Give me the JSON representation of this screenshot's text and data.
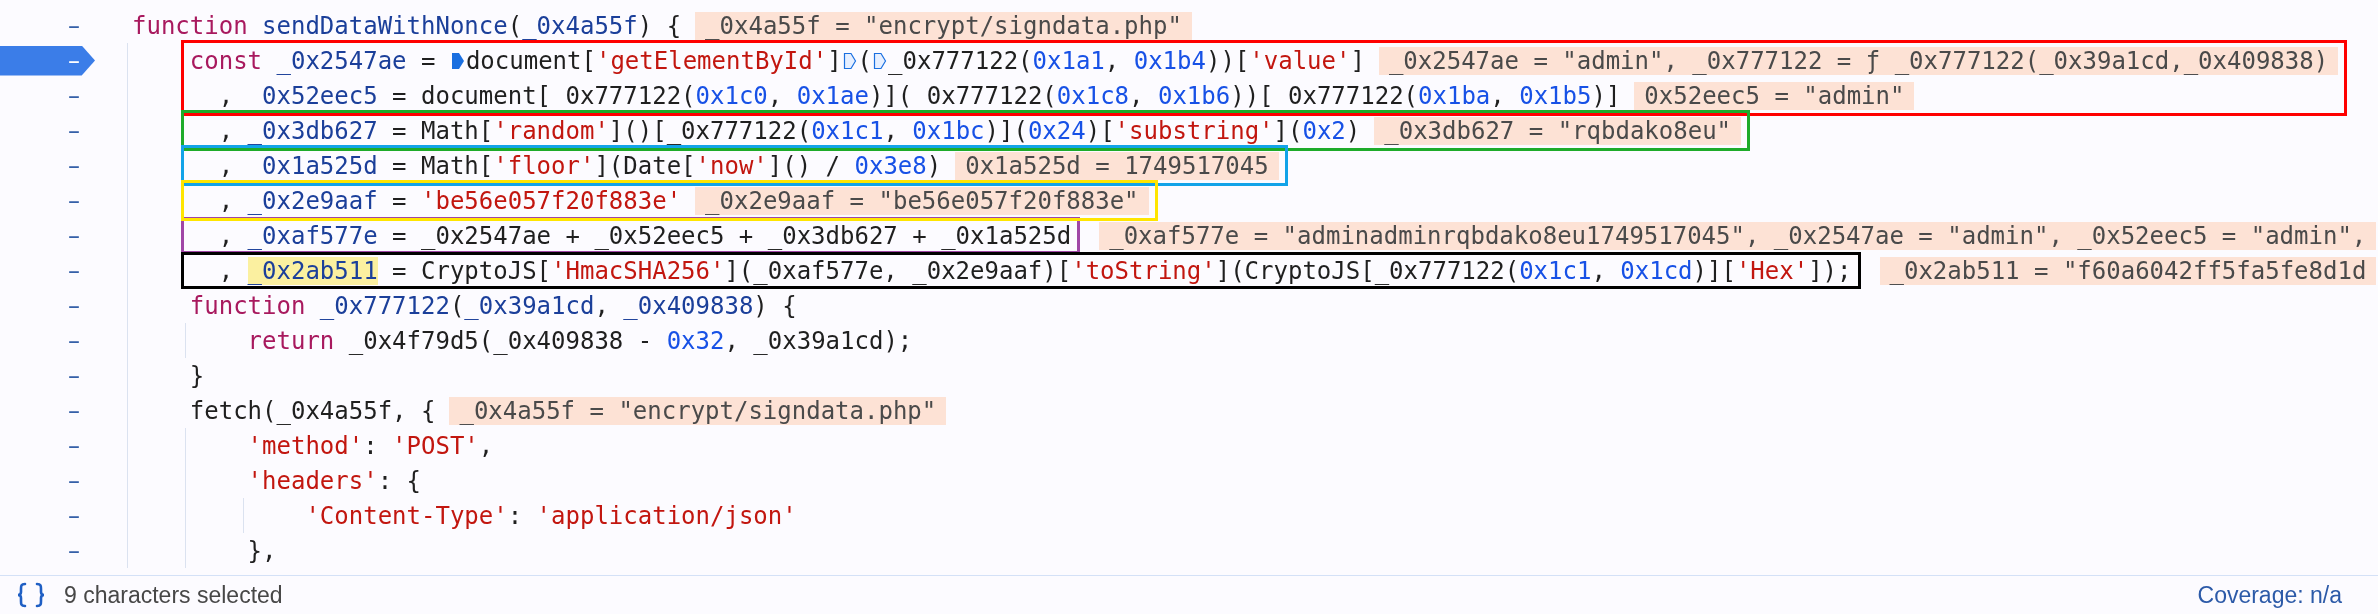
{
  "editor": {
    "lines": [
      {
        "gutter": "–",
        "breakpoint": false,
        "tokens": [
          {
            "text": "function",
            "kind": "keyword"
          },
          {
            "text": " sendDataWithNonce",
            "kind": "name"
          },
          {
            "text": "(",
            "kind": "plain"
          },
          {
            "text": "_0x4a55f",
            "kind": "name"
          },
          {
            "text": ") {",
            "kind": "plain"
          }
        ],
        "value": "_0x4a55f = \"encrypt/signdata.php\"",
        "children": [
          {
            "gutter": "–",
            "breakpoint": true,
            "color": "#ff0000",
            "value_in_frame": true,
            "tokens": [
              {
                "text": "const",
                "kind": "keyword"
              },
              {
                "text": " _0x2547ae",
                "kind": "name"
              },
              {
                "text": " = ",
                "kind": "plain"
              },
              {
                "kind": "marker-filled"
              },
              {
                "text": "document[",
                "kind": "plain"
              },
              {
                "text": "'getElementById'",
                "kind": "string"
              },
              {
                "text": "]",
                "kind": "plain"
              },
              {
                "kind": "marker-outline"
              },
              {
                "text": "(",
                "kind": "plain"
              },
              {
                "kind": "marker-outline"
              },
              {
                "text": "_0x777122(",
                "kind": "plain"
              },
              {
                "text": "0x1a1",
                "kind": "number"
              },
              {
                "text": ", ",
                "kind": "plain"
              },
              {
                "text": "0x1b4",
                "kind": "number"
              },
              {
                "text": "))[",
                "kind": "plain"
              },
              {
                "text": "'value'",
                "kind": "string"
              },
              {
                "text": "]",
                "kind": "plain"
              }
            ],
            "value": "_0x2547ae = \"admin\", _0x777122 = ƒ _0x777122(_0x39a1cd,_0x409838)"
          },
          {
            "gutter": "–",
            "breakpoint": false,
            "color": "#ff0000",
            "value_in_frame": true,
            "tokens": [
              {
                "text": "  ,  ",
                "kind": "plain"
              },
              {
                "text": "0x52eec5",
                "kind": "name"
              },
              {
                "text": " = document[ 0x777122(",
                "kind": "plain"
              },
              {
                "text": "0x1c0",
                "kind": "number"
              },
              {
                "text": ", ",
                "kind": "plain"
              },
              {
                "text": "0x1ae",
                "kind": "number"
              },
              {
                "text": ")]( 0x777122(",
                "kind": "plain"
              },
              {
                "text": "0x1c8",
                "kind": "number"
              },
              {
                "text": ", ",
                "kind": "plain"
              },
              {
                "text": "0x1b6",
                "kind": "number"
              },
              {
                "text": "))[ 0x777122(",
                "kind": "plain"
              },
              {
                "text": "0x1ba",
                "kind": "number"
              },
              {
                "text": ", ",
                "kind": "plain"
              },
              {
                "text": "0x1b5",
                "kind": "number"
              },
              {
                "text": ")]",
                "kind": "plain"
              }
            ],
            "value": "0x52eec5 = \"admin\""
          },
          {
            "gutter": "–",
            "breakpoint": false,
            "color": "#1eab2a",
            "value_in_frame": true,
            "tokens": [
              {
                "text": "  , ",
                "kind": "plain"
              },
              {
                "text": "_0x3db627",
                "kind": "name"
              },
              {
                "text": " = Math[",
                "kind": "plain"
              },
              {
                "text": "'random'",
                "kind": "string"
              },
              {
                "text": "]()[_0x777122(",
                "kind": "plain"
              },
              {
                "text": "0x1c1",
                "kind": "number"
              },
              {
                "text": ", ",
                "kind": "plain"
              },
              {
                "text": "0x1bc",
                "kind": "number"
              },
              {
                "text": ")](",
                "kind": "plain"
              },
              {
                "text": "0x24",
                "kind": "number"
              },
              {
                "text": ")[",
                "kind": "plain"
              },
              {
                "text": "'substring'",
                "kind": "string"
              },
              {
                "text": "](",
                "kind": "plain"
              },
              {
                "text": "0x2",
                "kind": "number"
              },
              {
                "text": ")",
                "kind": "plain"
              }
            ],
            "value": "_0x3db627 = \"rqbdako8eu\""
          },
          {
            "gutter": "–",
            "breakpoint": false,
            "color": "#12a3e8",
            "value_in_frame": true,
            "tokens": [
              {
                "text": "  ,  ",
                "kind": "plain"
              },
              {
                "text": "0x1a525d",
                "kind": "name"
              },
              {
                "text": " = Math[",
                "kind": "plain"
              },
              {
                "text": "'floor'",
                "kind": "string"
              },
              {
                "text": "](Date[",
                "kind": "plain"
              },
              {
                "text": "'now'",
                "kind": "string"
              },
              {
                "text": "]() / ",
                "kind": "plain"
              },
              {
                "text": "0x3e8",
                "kind": "number"
              },
              {
                "text": ")",
                "kind": "plain"
              }
            ],
            "value": "0x1a525d = 1749517045"
          },
          {
            "gutter": "–",
            "breakpoint": false,
            "color": "#ffe500",
            "value_in_frame": true,
            "tokens": [
              {
                "text": "  , ",
                "kind": "plain"
              },
              {
                "text": "_0x2e9aaf",
                "kind": "name"
              },
              {
                "text": " = ",
                "kind": "plain"
              },
              {
                "text": "'be56e057f20f883e'",
                "kind": "string"
              }
            ],
            "value": "_0x2e9aaf = \"be56e057f20f883e\""
          },
          {
            "gutter": "–",
            "breakpoint": false,
            "color": "#a046a6",
            "value_in_frame": false,
            "tokens": [
              {
                "text": "  , ",
                "kind": "plain"
              },
              {
                "text": "_0xaf577e",
                "kind": "name"
              },
              {
                "text": " = _0x2547ae + _0x52eec5 + _0x3db627 + _0x1a525d",
                "kind": "plain"
              }
            ],
            "value": "_0xaf577e = \"adminadminrqbdako8eu1749517045\", _0x2547ae = \"admin\", _0x52eec5 = \"admin\","
          },
          {
            "gutter": "–",
            "breakpoint": false,
            "color": "#000000",
            "value_in_frame": false,
            "tokens": [
              {
                "text": "  , ",
                "kind": "plain"
              },
              {
                "text": "_0x2ab511",
                "kind": "selected"
              },
              {
                "text": " = CryptoJS[",
                "kind": "plain"
              },
              {
                "text": "'HmacSHA256'",
                "kind": "string"
              },
              {
                "text": "](_0xaf577e, _0x2e9aaf)[",
                "kind": "plain"
              },
              {
                "text": "'toString'",
                "kind": "string"
              },
              {
                "text": "](CryptoJS[_0x777122(",
                "kind": "plain"
              },
              {
                "text": "0x1c1",
                "kind": "number"
              },
              {
                "text": ", ",
                "kind": "plain"
              },
              {
                "text": "0x1cd",
                "kind": "number"
              },
              {
                "text": ")][",
                "kind": "plain"
              },
              {
                "text": "'Hex'",
                "kind": "string"
              },
              {
                "text": "]);",
                "kind": "plain"
              }
            ],
            "value": "_0x2ab511 = \"f60a6042ff5fa5fe8d1d"
          },
          {
            "gutter": "–",
            "breakpoint": false,
            "tokens": [
              {
                "text": "function",
                "kind": "keyword"
              },
              {
                "text": " _0x777122",
                "kind": "name"
              },
              {
                "text": "(",
                "kind": "plain"
              },
              {
                "text": "_0x39a1cd",
                "kind": "name"
              },
              {
                "text": ", ",
                "kind": "plain"
              },
              {
                "text": "_0x409838",
                "kind": "name"
              },
              {
                "text": ") {",
                "kind": "plain"
              }
            ],
            "children": [
              {
                "gutter": "–",
                "breakpoint": false,
                "tokens": [
                  {
                    "text": "return",
                    "kind": "keyword"
                  },
                  {
                    "text": " _0x4f79d5(_0x409838 - ",
                    "kind": "plain"
                  },
                  {
                    "text": "0x32",
                    "kind": "number"
                  },
                  {
                    "text": ", _0x39a1cd);",
                    "kind": "plain"
                  }
                ]
              }
            ]
          },
          {
            "gutter": "–",
            "breakpoint": false,
            "tokens": [
              {
                "text": "}",
                "kind": "plain"
              }
            ]
          },
          {
            "gutter": "–",
            "breakpoint": false,
            "tokens": [
              {
                "text": "fetch(_0x4a55f, {",
                "kind": "plain"
              }
            ],
            "value": "_0x4a55f = \"encrypt/signdata.php\"",
            "children": [
              {
                "gutter": "–",
                "breakpoint": false,
                "tokens": [
                  {
                    "text": "'method'",
                    "kind": "string"
                  },
                  {
                    "text": ": ",
                    "kind": "plain"
                  },
                  {
                    "text": "'POST'",
                    "kind": "string"
                  },
                  {
                    "text": ",",
                    "kind": "plain"
                  }
                ]
              },
              {
                "gutter": "–",
                "breakpoint": false,
                "tokens": [
                  {
                    "text": "'headers'",
                    "kind": "string"
                  },
                  {
                    "text": ": {",
                    "kind": "plain"
                  }
                ],
                "children": [
                  {
                    "gutter": "–",
                    "breakpoint": false,
                    "tokens": [
                      {
                        "text": "'Content-Type'",
                        "kind": "string"
                      },
                      {
                        "text": ": ",
                        "kind": "plain"
                      },
                      {
                        "text": "'application/json'",
                        "kind": "string"
                      }
                    ]
                  }
                ]
              },
              {
                "gutter": "–",
                "breakpoint": false,
                "tokens": [
                  {
                    "text": "},",
                    "kind": "plain"
                  }
                ]
              }
            ]
          }
        ]
      }
    ]
  },
  "status_bar": {
    "selection": "9 characters selected",
    "coverage": "Coverage: n/a"
  }
}
